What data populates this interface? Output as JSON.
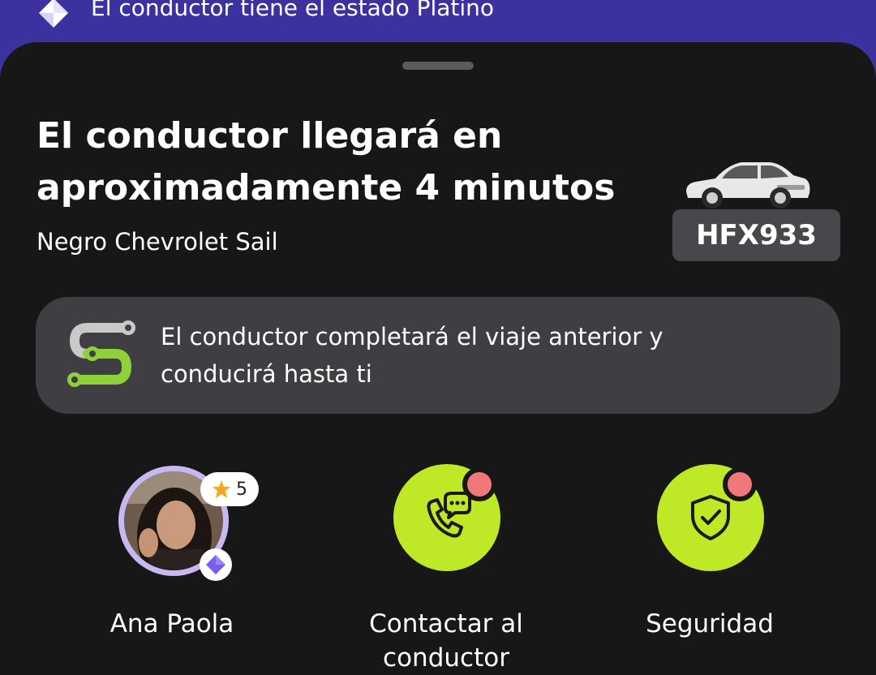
{
  "banner": {
    "icon": "diamond-icon",
    "text": "El conductor tiene el estado Platino",
    "background": "#3b32a0"
  },
  "trip": {
    "title": "El conductor llegará en aproximadamente 4 minutos",
    "vehicle_description": "Negro Chevrolet Sail",
    "plate": "HFX933",
    "vehicle_icon": "car-icon"
  },
  "notice": {
    "icon": "route-icon",
    "text": "El conductor completará el viaje anterior y conducirá hasta ti"
  },
  "driver": {
    "name": "Ana Paola",
    "rating": "5",
    "rating_icon": "star-icon",
    "tier_icon": "diamond-icon"
  },
  "actions": [
    {
      "label": "Contactar al conductor",
      "icon": "phone-chat-icon"
    },
    {
      "label": "Seguridad",
      "icon": "shield-check-icon"
    }
  ],
  "colors": {
    "accent": "#bfe826",
    "notification_dot": "#f07878",
    "sheet": "#171717",
    "card": "#3f3f43",
    "platinum": "#c7b8f2"
  }
}
